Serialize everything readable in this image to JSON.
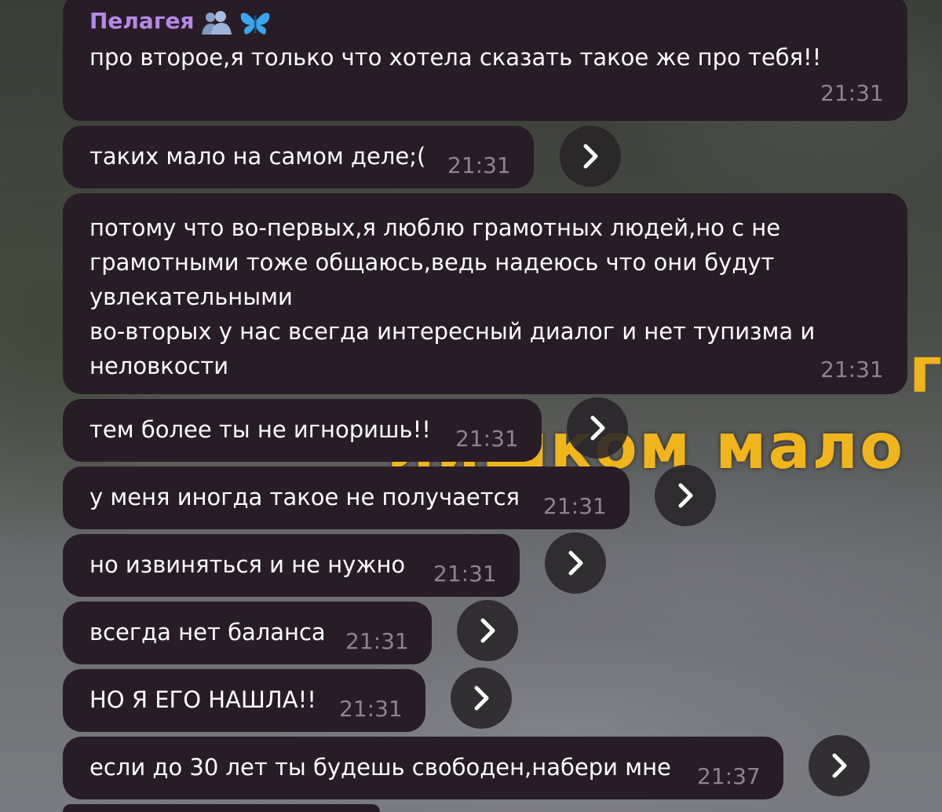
{
  "background": {
    "overlay_text": "лишком мало",
    "overlay_letter": "г"
  },
  "messages": [
    {
      "sender": "Пелагея",
      "text": "про второе,я только что хотела сказать такое же про тебя!!",
      "time": "21:31"
    },
    {
      "text": "таких мало на самом деле;(",
      "time": "21:31",
      "forward_icon": "chevron-right-icon"
    },
    {
      "lines": [
        "потому что во-первых,я люблю грамотных людей,но с не",
        "грамотными тоже общаюсь,ведь надеюсь что они будут",
        "увлекательными",
        "во-вторых у нас всегда интересный диалог и нет тупизма и",
        "неловкости"
      ],
      "time": "21:31"
    },
    {
      "text": "тем более ты не игноришь!!",
      "time": "21:31",
      "forward_icon": "chevron-right-icon"
    },
    {
      "text": "у меня иногда такое не получается",
      "time": "21:31",
      "forward_icon": "chevron-right-icon"
    },
    {
      "text": "но извиняться и не нужно",
      "time": "21:31",
      "forward_icon": "chevron-right-icon"
    },
    {
      "text": "всегда нет баланса",
      "time": "21:31",
      "forward_icon": "chevron-right-icon"
    },
    {
      "text": "НО Я ЕГО НАШЛА!!",
      "time": "21:31",
      "forward_icon": "chevron-right-icon"
    },
    {
      "text": "если до 30 лет ты будешь свободен,набери мне",
      "time": "21:37",
      "forward_icon": "chevron-right-icon"
    }
  ],
  "colors": {
    "bubble": "#281d26",
    "sender": "#b38ae6",
    "time": "#8e8491",
    "text": "#ffffff"
  }
}
